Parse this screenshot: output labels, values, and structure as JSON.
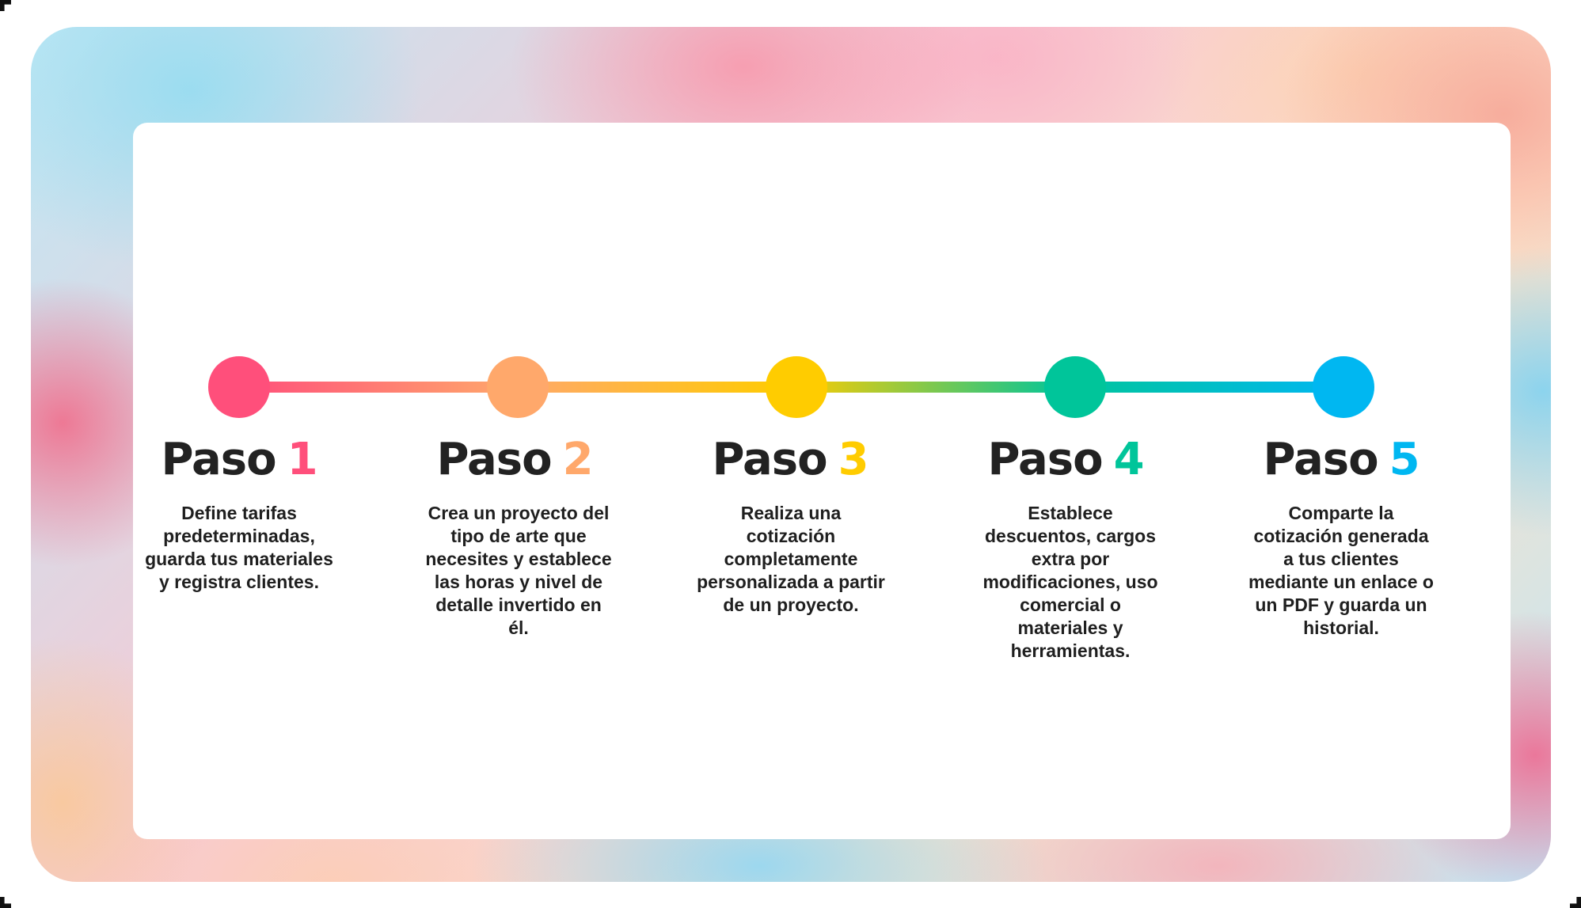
{
  "steps": [
    {
      "word": "Paso",
      "number": "1",
      "color": "#ff4f7b",
      "description": "Define tarifas predeterminadas, guarda tus materiales y registra clientes."
    },
    {
      "word": "Paso",
      "number": "2",
      "color": "#ffa86b",
      "description": "Crea un proyecto del tipo de arte que necesites y establece las horas y nivel de detalle invertido en él."
    },
    {
      "word": "Paso",
      "number": "3",
      "color": "#ffcc00",
      "description": "Realiza una cotización completamente personalizada a partir de un proyecto."
    },
    {
      "word": "Paso",
      "number": "4",
      "color": "#00c59a",
      "description": "Establece descuentos, cargos extra por modificaciones, uso comercial o materiales y herramientas."
    },
    {
      "word": "Paso",
      "number": "5",
      "color": "#00b7f1",
      "description": "Comparte la cotización generada a tus clientes mediante un enlace o un PDF y guarda un historial."
    }
  ]
}
